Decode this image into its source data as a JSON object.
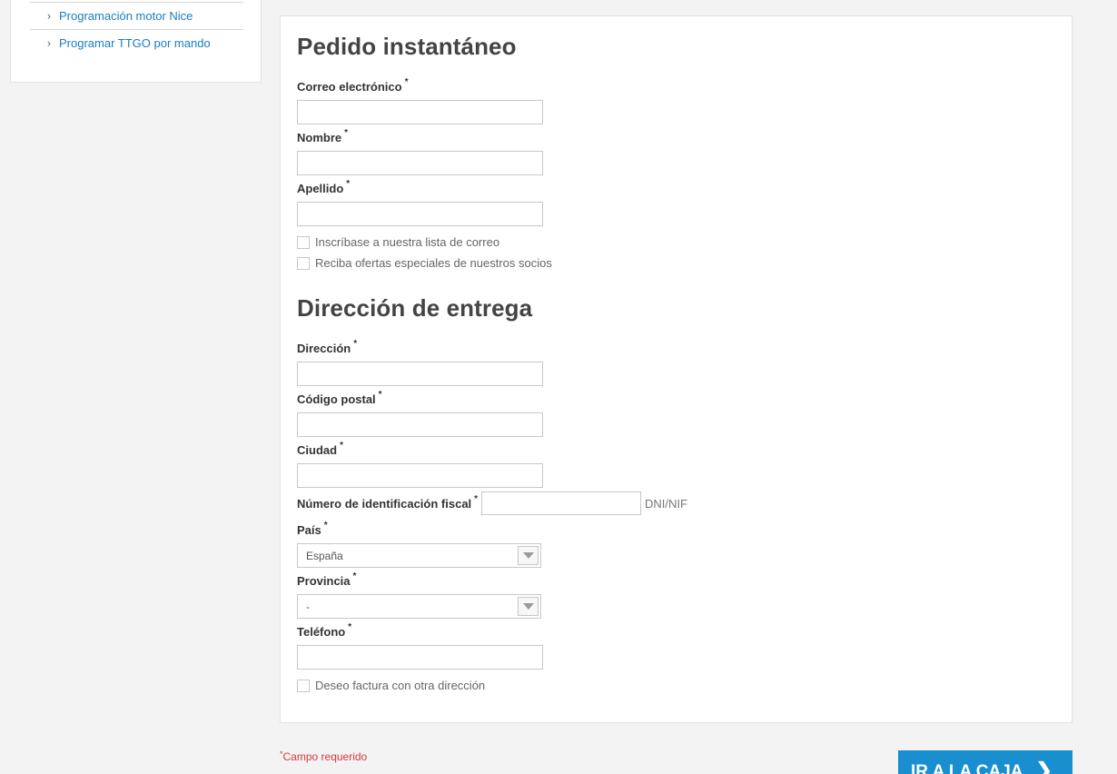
{
  "sidebar": {
    "links": [
      {
        "label": "Programación motor Nice"
      },
      {
        "label": "Programar TTGO por mando"
      }
    ]
  },
  "order": {
    "title": "Pedido instantáneo",
    "fields": {
      "email": {
        "label": "Correo electrónico",
        "value": ""
      },
      "first_name": {
        "label": "Nombre",
        "value": ""
      },
      "last_name": {
        "label": "Apellido",
        "value": ""
      }
    },
    "checkboxes": {
      "newsletter": "Inscríbase a nuestra lista de correo",
      "partner_offers": "Reciba ofertas especiales de nuestros socios"
    }
  },
  "delivery": {
    "title": "Dirección de entrega",
    "fields": {
      "address": {
        "label": "Dirección",
        "value": ""
      },
      "postal_code": {
        "label": "Código postal",
        "value": ""
      },
      "city": {
        "label": "Ciudad",
        "value": ""
      },
      "tax_id": {
        "label": "Número de identificación fiscal",
        "value": "",
        "hint": "DNI/NIF"
      },
      "country": {
        "label": "País",
        "selected": "España"
      },
      "province": {
        "label": "Provincia",
        "selected": "-"
      },
      "phone": {
        "label": "Teléfono",
        "value": ""
      }
    },
    "checkboxes": {
      "other_billing": "Deseo factura con otra dirección"
    },
    "required_mark": "*"
  },
  "footer": {
    "required_note": "Campo requerido",
    "required_star": "*",
    "checkout_label": "IR A LA CAJA",
    "checkout_chevron": "❯"
  },
  "colors": {
    "accent": "#1a8fd0",
    "link": "#1a7dbf",
    "required": "#d9383f"
  }
}
